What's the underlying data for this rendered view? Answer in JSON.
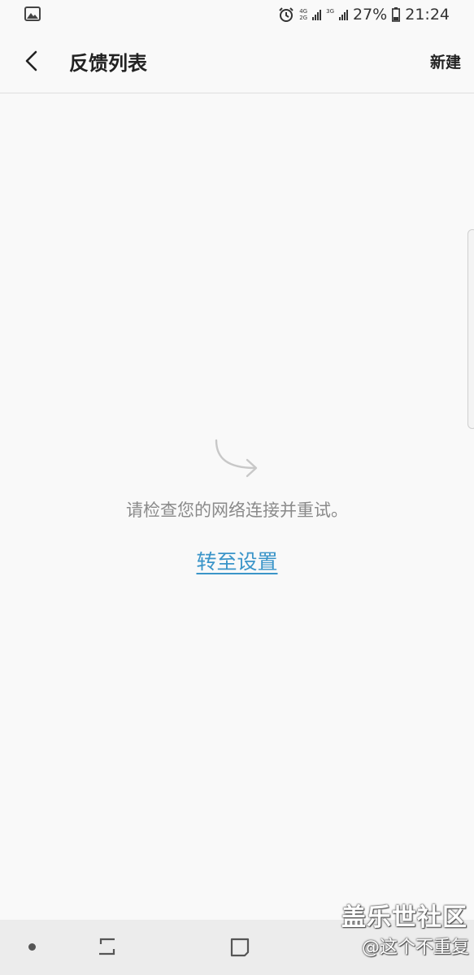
{
  "status_bar": {
    "left_icon": "image-notification-icon",
    "alarm_icon": "alarm-icon",
    "sim1_network_top": "4G",
    "sim1_network_bottom": "2G",
    "sim2_network": "3G",
    "battery_percent": "27%",
    "time": "21:24"
  },
  "header": {
    "back_icon": "chevron-left-icon",
    "title": "反馈列表",
    "new_label": "新建"
  },
  "empty_state": {
    "icon": "curved-arrow-icon",
    "message": "请检查您的网络连接并重试。",
    "settings_link": "转至设置"
  },
  "nav_bar": {
    "dot_icon": "dot-icon",
    "recent_icon": "recent-apps-icon",
    "home_icon": "home-square-icon"
  },
  "watermark": {
    "line1": "盖乐世社区",
    "line2": "@这个不重复"
  },
  "colors": {
    "background": "#f9f9f9",
    "link": "#3b95c9",
    "message": "#8a8a8a",
    "nav_bar": "#ececec"
  }
}
